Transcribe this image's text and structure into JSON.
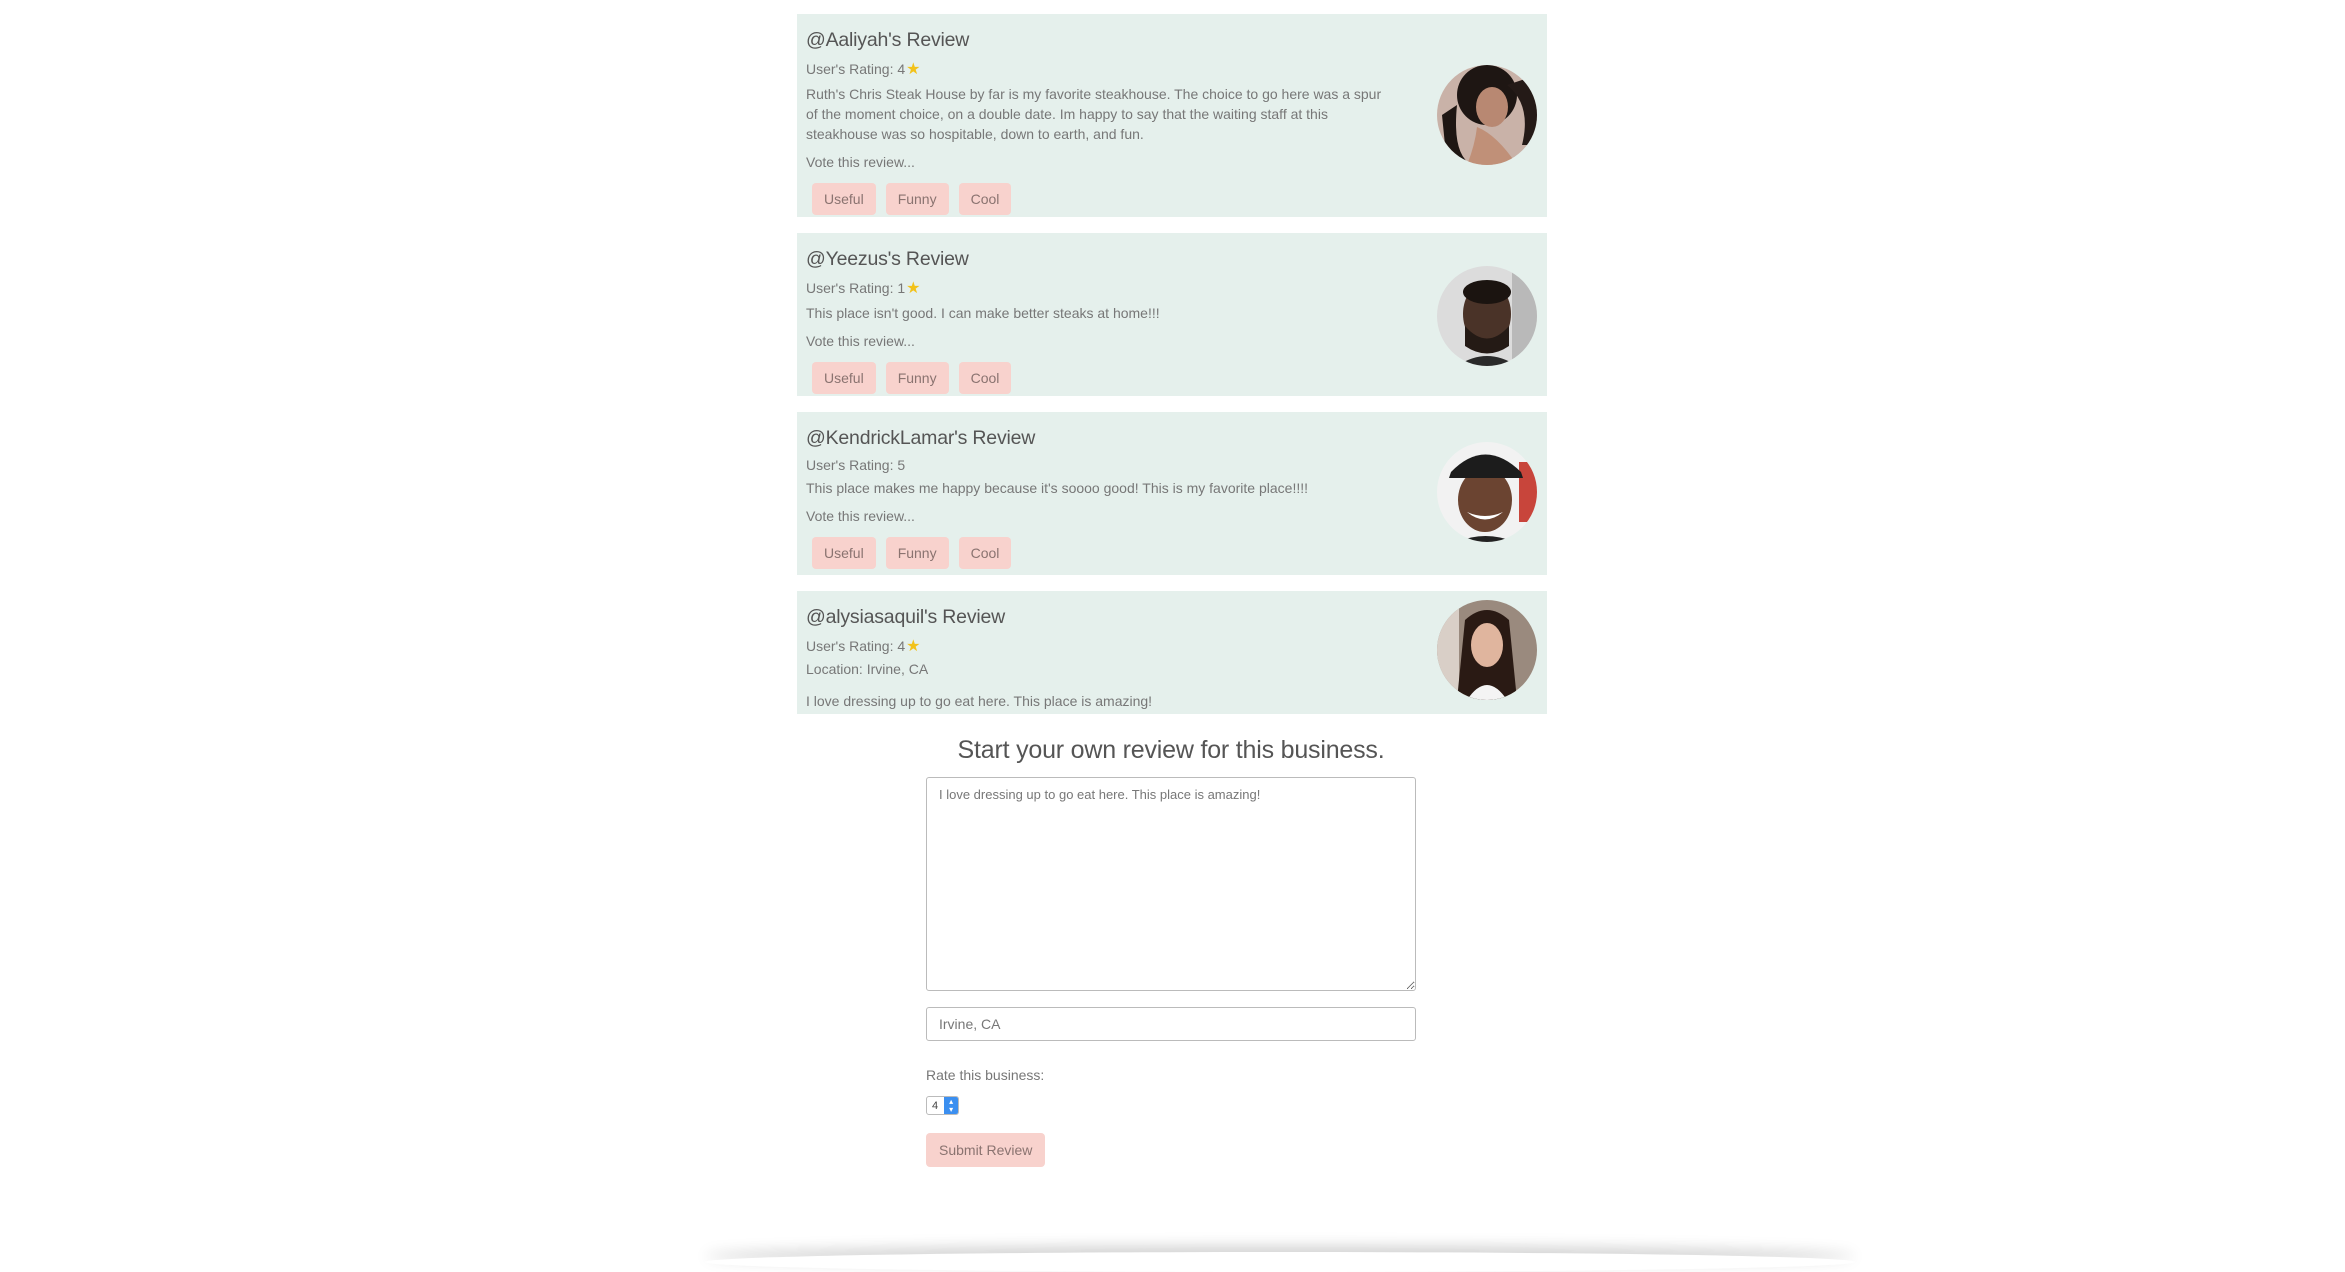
{
  "reviews": [
    {
      "title": "@Aaliyah's Review",
      "rating_label": "User's Rating: 4",
      "text": "Ruth's Chris Steak House by far is my favorite steakhouse. The choice to go here was a spur of the moment choice, on a double date. Im happy to say that the waiting staff at this steakhouse was so hospitable, down to earth, and fun.",
      "vote_label": "Vote this review...",
      "buttons": [
        "Useful",
        "Funny",
        "Cool"
      ]
    },
    {
      "title": "@Yeezus's Review",
      "rating_label": "User's Rating: 1",
      "text": "This place isn't good. I can make better steaks at home!!!",
      "vote_label": "Vote this review...",
      "buttons": [
        "Useful",
        "Funny",
        "Cool"
      ]
    },
    {
      "title": "@KendrickLamar's Review",
      "rating_label": "User's Rating: 5",
      "text": "This place makes me happy because it's soooo good! This is my favorite place!!!!",
      "vote_label": "Vote this review...",
      "buttons": [
        "Useful",
        "Funny",
        "Cool"
      ]
    },
    {
      "title": "@alysiasaquil's Review",
      "rating_label": "User's Rating: 4",
      "location": "Location: Irvine, CA",
      "text": "I love dressing up to go eat here. This place is amazing!"
    }
  ],
  "form": {
    "title": "Start your own review for this business.",
    "review_text": "I love dressing up to go eat here. This place is amazing!",
    "location_value": "Irvine, CA",
    "rate_label": "Rate this business:",
    "rate_value": "4",
    "submit_label": "Submit Review"
  },
  "icons": {
    "star": "star-icon",
    "select_arrows": "chevron-up-down-icon"
  },
  "colors": {
    "card_bg": "#e5f0ec",
    "button_bg": "#f8d2cd",
    "star": "#f2c21a",
    "select_accent": "#3b8ff0"
  }
}
